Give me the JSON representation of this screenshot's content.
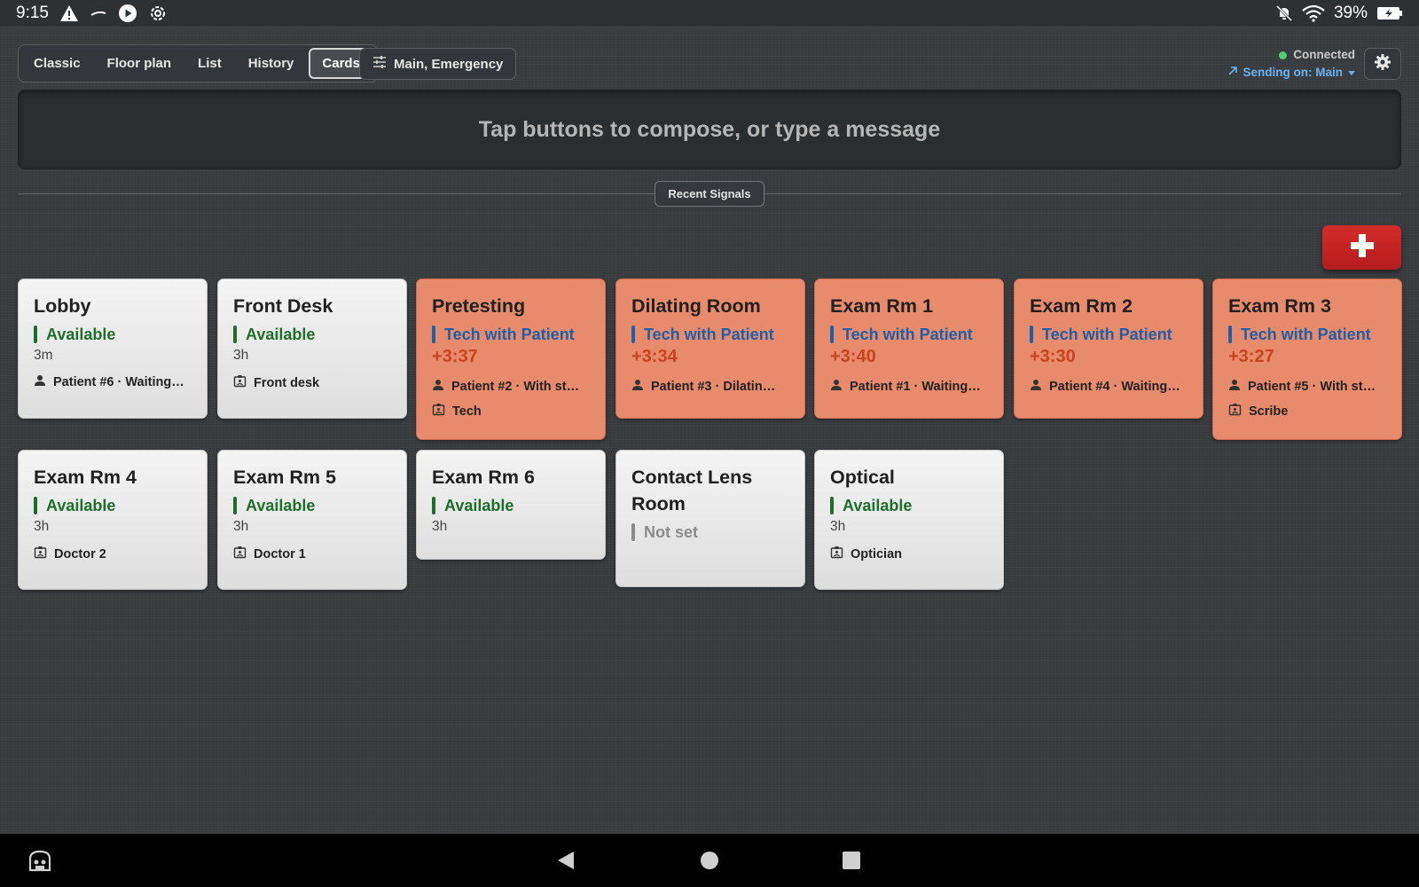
{
  "status_bar": {
    "time": "9:15",
    "battery": "39%",
    "icons_left": [
      "warning-icon",
      "dash-icon",
      "play-icon",
      "settings-gear-icon"
    ],
    "icons_right": [
      "bell-off-icon",
      "wifi-icon",
      "battery-charging-icon"
    ]
  },
  "tabs": [
    {
      "label": "Classic",
      "active": false
    },
    {
      "label": "Floor plan",
      "active": false
    },
    {
      "label": "List",
      "active": false
    },
    {
      "label": "History",
      "active": false
    },
    {
      "label": "Cards",
      "active": true
    }
  ],
  "filter": {
    "label": "Main, Emergency",
    "icon": "sliders-icon"
  },
  "connection": {
    "status": "Connected",
    "sending": "Sending on: Main"
  },
  "composer": {
    "placeholder": "Tap buttons to compose, or type a message",
    "value": ""
  },
  "recent_signals_label": "Recent Signals",
  "emergency_button_icon": "plus-icon",
  "colors": {
    "available": "#1d6e2a",
    "tech_with_patient": "#1d5fa8",
    "not_set": "#8b8b8b",
    "timer": "#c8431e",
    "busy_card": "#e88b6c",
    "emergency": "#c62424",
    "connected_dot": "#4fcf6e",
    "sending_link": "#68b2f0"
  },
  "rooms": [
    {
      "name": "Lobby",
      "status": "Available",
      "status_color": "green",
      "since": "3m",
      "timer": "",
      "lines": [
        {
          "icon": "person-icon",
          "text": "Patient #6 · Waiting…"
        }
      ]
    },
    {
      "name": "Front Desk",
      "status": "Available",
      "status_color": "green",
      "since": "3h",
      "timer": "",
      "lines": [
        {
          "icon": "badge-icon",
          "text": "Front desk"
        }
      ]
    },
    {
      "name": "Pretesting",
      "status": "Tech with Patient",
      "status_color": "blue",
      "since": "",
      "timer": "+3:37",
      "lines": [
        {
          "icon": "person-icon",
          "text": "Patient #2 · With st…"
        },
        {
          "icon": "badge-icon",
          "text": "Tech"
        }
      ]
    },
    {
      "name": "Dilating Room",
      "status": "Tech with Patient",
      "status_color": "blue",
      "since": "",
      "timer": "+3:34",
      "lines": [
        {
          "icon": "person-icon",
          "text": "Patient #3 · Dilatin…"
        }
      ]
    },
    {
      "name": "Exam Rm 1",
      "status": "Tech with Patient",
      "status_color": "blue",
      "since": "",
      "timer": "+3:40",
      "lines": [
        {
          "icon": "person-icon",
          "text": "Patient #1 · Waiting…"
        }
      ]
    },
    {
      "name": "Exam Rm 2",
      "status": "Tech with Patient",
      "status_color": "blue",
      "since": "",
      "timer": "+3:30",
      "lines": [
        {
          "icon": "person-icon",
          "text": "Patient #4 · Waiting…"
        }
      ]
    },
    {
      "name": "Exam Rm 3",
      "status": "Tech with Patient",
      "status_color": "blue",
      "since": "",
      "timer": "+3:27",
      "lines": [
        {
          "icon": "person-icon",
          "text": "Patient #5 · With st…"
        },
        {
          "icon": "badge-icon",
          "text": "Scribe"
        }
      ]
    },
    {
      "name": "Exam Rm 4",
      "status": "Available",
      "status_color": "green",
      "since": "3h",
      "timer": "",
      "lines": [
        {
          "icon": "badge-icon",
          "text": "Doctor 2"
        }
      ]
    },
    {
      "name": "Exam Rm 5",
      "status": "Available",
      "status_color": "green",
      "since": "3h",
      "timer": "",
      "lines": [
        {
          "icon": "badge-icon",
          "text": "Doctor 1"
        }
      ]
    },
    {
      "name": "Exam Rm 6",
      "status": "Available",
      "status_color": "green",
      "since": "3h",
      "timer": "",
      "lines": []
    },
    {
      "name": "Contact Lens Room",
      "status": "Not set",
      "status_color": "grey",
      "since": "",
      "timer": "",
      "lines": []
    },
    {
      "name": "Optical",
      "status": "Available",
      "status_color": "green",
      "since": "3h",
      "timer": "",
      "lines": [
        {
          "icon": "badge-icon",
          "text": "Optician"
        }
      ]
    }
  ],
  "nav_bar": {
    "icons": [
      "app-launcher-icon",
      "back-icon",
      "home-icon",
      "recents-icon"
    ]
  }
}
